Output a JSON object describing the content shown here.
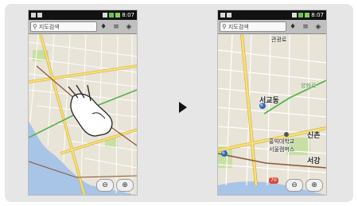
{
  "status_bar": {
    "time": "8:07"
  },
  "search": {
    "placeholder": "지도검색"
  },
  "map_labels": {
    "top": "관광로",
    "district_big": "서교동",
    "route_right": "양화로",
    "university_line1": "홍익대학교",
    "university_line2": "서울캠퍼스",
    "district_right": "신촌",
    "district_right_bottom": "서강",
    "route_badge_mid": "6",
    "route_badge_left": "6",
    "route_badge_bottom": "70"
  },
  "colors": {
    "map_base": "#e9e4d8",
    "water": "#a8c4e6",
    "park": "#c7dfa4",
    "major_road": "#f7e174",
    "road_outline": "#d2b24c",
    "rail": "#8b5a3c",
    "subway_green": "#56b24c"
  },
  "icons": {
    "search": "search-icon",
    "pin": "place-pin-icon",
    "layers": "layers-icon",
    "mylocation": "my-location-icon",
    "zoom_out": "zoom-out-icon",
    "zoom_in": "zoom-in-icon",
    "gesture": "pinch-zoom-hand-icon",
    "next": "next-arrow-icon"
  }
}
